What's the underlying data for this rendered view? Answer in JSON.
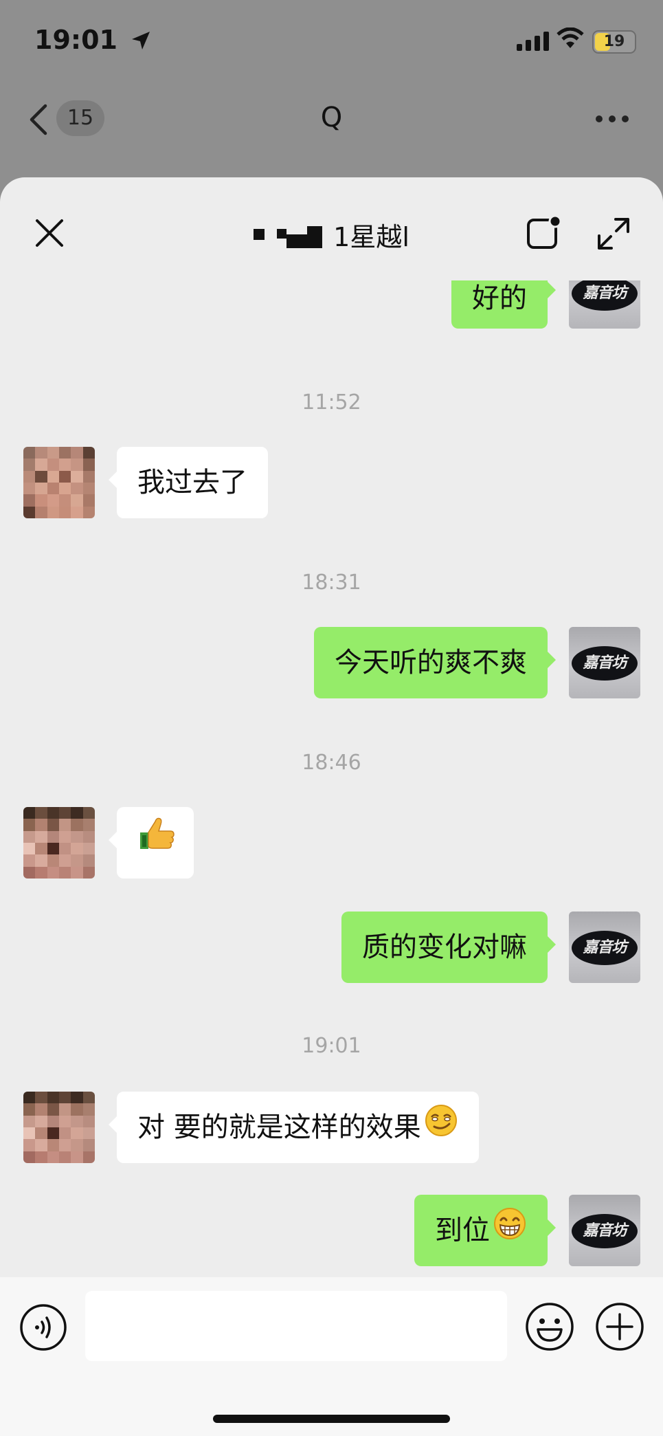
{
  "status_bar": {
    "time": "19:01",
    "battery": "19",
    "battery_level": 0.19
  },
  "background_nav": {
    "badge": "15",
    "title": "Q"
  },
  "chat": {
    "title": "1星越l",
    "messages": [
      {
        "kind": "out",
        "text": "好的"
      },
      {
        "kind": "time",
        "text": "11:52"
      },
      {
        "kind": "in",
        "text": "我过去了"
      },
      {
        "kind": "time",
        "text": "18:31"
      },
      {
        "kind": "out",
        "text": "今天听的爽不爽"
      },
      {
        "kind": "time",
        "text": "18:46"
      },
      {
        "kind": "in",
        "text": "",
        "emoji": "thumbs-up"
      },
      {
        "kind": "out",
        "text": "质的变化对嘛"
      },
      {
        "kind": "time",
        "text": "19:01"
      },
      {
        "kind": "in",
        "text": "对 要的就是这样的效果",
        "emoji": "smirk-face"
      },
      {
        "kind": "out",
        "text": "到位",
        "emoji": "grin-face"
      }
    ],
    "brand_avatar_text": "嘉音坊"
  },
  "input": {
    "value": "",
    "placeholder": ""
  },
  "colors": {
    "sheet_bg": "#ededed",
    "out_bubble": "#95ec69",
    "in_bubble": "#ffffff",
    "timestamp": "#a5a5a5"
  }
}
